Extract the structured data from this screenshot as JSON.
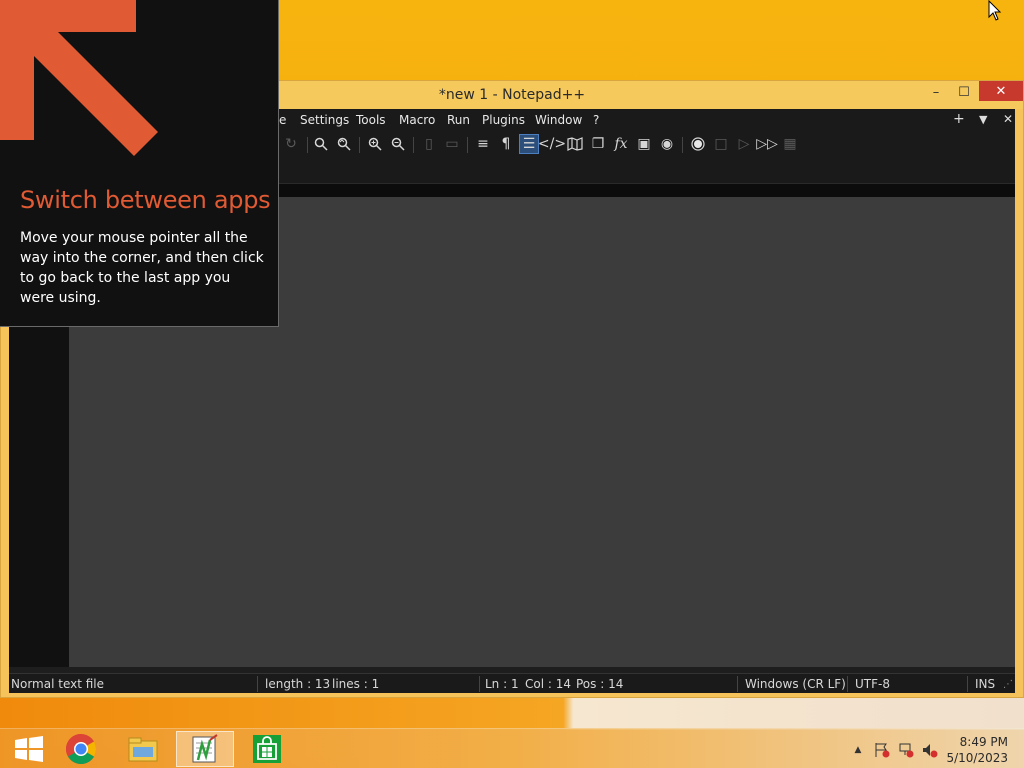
{
  "window": {
    "title": "*new 1 - Notepad++",
    "minimize": "–",
    "maximize": "☐",
    "close": "✕"
  },
  "menu": {
    "items": [
      "e",
      "Settings",
      "Tools",
      "Macro",
      "Run",
      "Plugins",
      "Window",
      "?"
    ],
    "right": [
      "+",
      "▼",
      "✕"
    ]
  },
  "toolbar_icons": [
    "redo-icon",
    "find-icon",
    "replace-icon",
    "zoom-in-icon",
    "zoom-out-icon",
    "sync-vertical-icon",
    "sync-horizontal-icon",
    "word-wrap-icon",
    "show-all-characters-icon",
    "indent-guide-icon",
    "udl-icon",
    "document-map-icon",
    "document-list-icon",
    "function-list-icon",
    "folder-as-workspace-icon",
    "monitoring-icon",
    "record-macro-icon",
    "stop-macro-icon",
    "play-macro-icon",
    "run-macro-multiple-icon",
    "save-macro-icon"
  ],
  "status": {
    "file_type": "Normal text file",
    "length": "length : 13",
    "lines": "lines : 1",
    "ln": "Ln : 1",
    "col": "Col : 14",
    "pos": "Pos : 14",
    "eol": "Windows (CR LF)",
    "encoding": "UTF-8",
    "mode": "INS"
  },
  "tip": {
    "title": "Switch between apps",
    "body": "Move your mouse pointer all the way into the corner, and then click to go back to the last app you were using."
  },
  "taskbar": {
    "apps": [
      "start-icon",
      "chrome-icon",
      "file-explorer-icon",
      "notepad-plus-plus-icon",
      "store-icon"
    ],
    "clock_time": "8:49 PM",
    "clock_date": "5/10/2023"
  },
  "colors": {
    "accent": "#e05a34",
    "desktop": "#f4a410",
    "window_frame": "#f5c35a"
  }
}
